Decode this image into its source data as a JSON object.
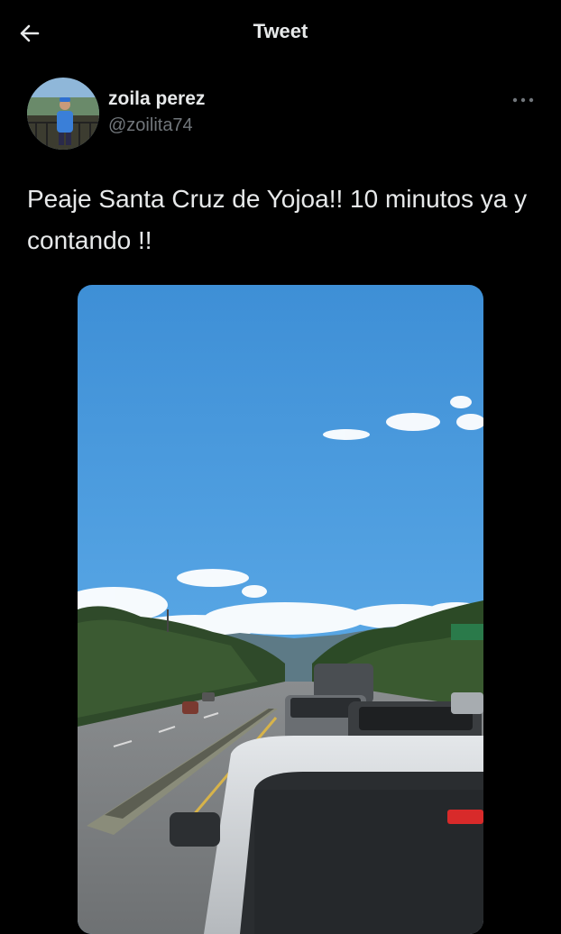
{
  "header": {
    "title": "Tweet"
  },
  "tweet": {
    "author": {
      "display_name": "zoila perez",
      "handle": "@zoilita74"
    },
    "text": "Peaje Santa Cruz de Yojoa!! 10 minutos ya y contando !!"
  },
  "icons": {
    "back": "arrow-left-icon",
    "more": "ellipsis-icon"
  },
  "colors": {
    "background": "#000000",
    "primary_text": "#e7e9ea",
    "secondary_text": "#71767b",
    "sky": "#4a9be0"
  }
}
